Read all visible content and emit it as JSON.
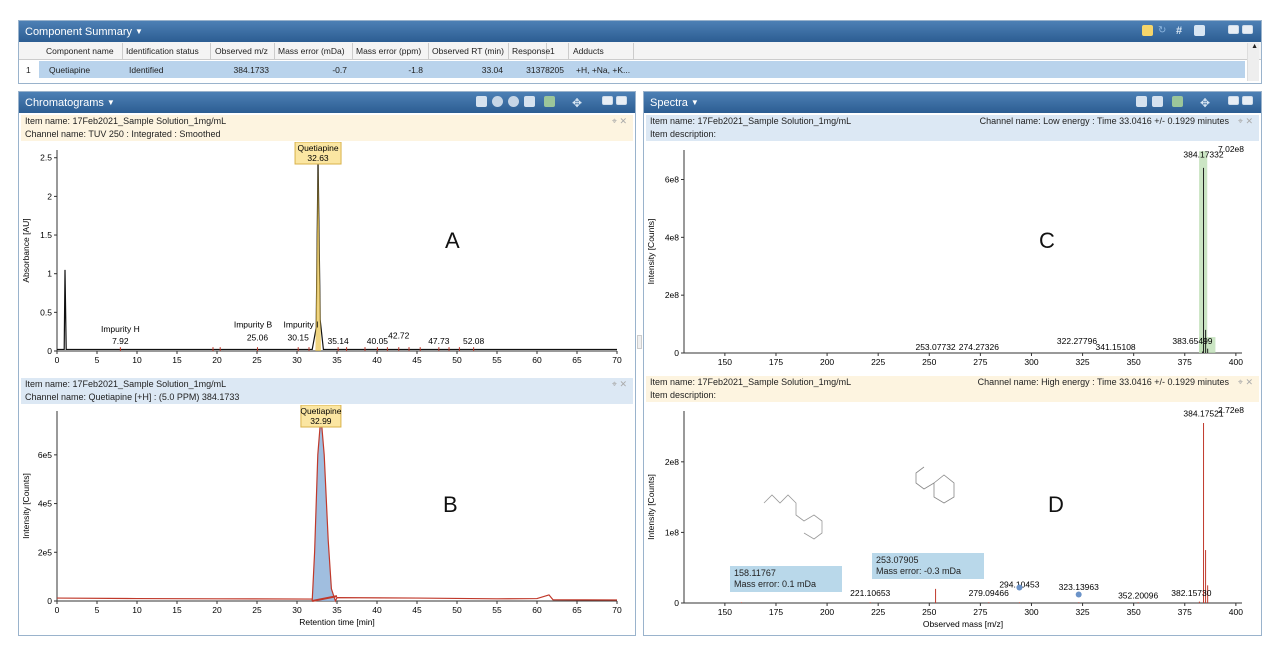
{
  "summary": {
    "title": "Component Summary",
    "columns": [
      "Component name",
      "Identification status",
      "Observed m/z",
      "Mass error (mDa)",
      "Mass error (ppm)",
      "Observed RT (min)",
      "Response",
      "Adducts"
    ],
    "response_sort": "1",
    "row": {
      "index": "1",
      "name": "Quetiapine",
      "status": "Identified",
      "mz": "384.1733",
      "err_mda": "-0.7",
      "err_ppm": "-1.8",
      "rt": "33.04",
      "response": "31378205",
      "adducts": "+H, +Na, +K..."
    }
  },
  "chromatograms": {
    "title": "Chromatograms",
    "a": {
      "item": "Item name: 17Feb2021_Sample Solution_1mg/mL",
      "channel": "Channel name: TUV 250 : Integrated : Smoothed",
      "ylabel": "Absorbance [AU]",
      "letter": "A",
      "yticks": [
        "0",
        "0.5",
        "1",
        "1.5",
        "2",
        "2.5"
      ],
      "peak_label": "Quetiapine",
      "peak_rt": "32.63",
      "impurity_h": "Impurity H",
      "impurity_b": "Impurity B",
      "impurity_i": "Impurity I",
      "annotations": [
        "7.92",
        "25.06",
        "30.15",
        "35.14",
        "40.05",
        "42.72",
        "47.73",
        "52.08"
      ]
    },
    "b": {
      "item": "Item name: 17Feb2021_Sample Solution_1mg/mL",
      "channel": "Channel name: Quetiapine [+H] : (5.0 PPM) 384.1733",
      "ylabel": "Intensity [Counts]",
      "letter": "B",
      "yticks": [
        "0",
        "2e5",
        "4e5",
        "6e5"
      ],
      "peak_label": "Quetiapine",
      "peak_rt": "32.99",
      "xlabel": "Retention time [min]"
    },
    "xticks": [
      "0",
      "5",
      "10",
      "15",
      "20",
      "25",
      "30",
      "35",
      "40",
      "45",
      "50",
      "55",
      "60",
      "65",
      "70"
    ]
  },
  "spectra": {
    "title": "Spectra",
    "c": {
      "item": "Item name: 17Feb2021_Sample Solution_1mg/mL",
      "channel": "Channel name: Low energy : Time 33.0416 +/- 0.1929 minutes",
      "desc": "Item description:",
      "ylabel": "Intensity [Counts]",
      "letter": "C",
      "max": "7.02e8",
      "yticks": [
        "0",
        "2e8",
        "4e8",
        "6e8"
      ],
      "peaks": [
        "253.07732",
        "274.27326",
        "322.27796",
        "341.15108",
        "383.65499",
        "384.17332"
      ]
    },
    "d": {
      "item": "Item name: 17Feb2021_Sample Solution_1mg/mL",
      "channel": "Channel name: High energy : Time 33.0416 +/- 0.1929 minutes",
      "desc": "Item description:",
      "ylabel": "Intensity [Counts]",
      "letter": "D",
      "max": "2.72e8",
      "yticks": [
        "0",
        "1e8",
        "2e8"
      ],
      "peaks": [
        "221.10653",
        "279.09466",
        "294.10453",
        "323.13963",
        "352.20096",
        "382.15730",
        "384.17521"
      ],
      "box1_mass": "158.11767",
      "box1_err": "Mass error: 0.1 mDa",
      "box2_mass": "253.07905",
      "box2_err": "Mass error: -0.3 mDa",
      "xlabel": "Observed mass [m/z]"
    },
    "xticks": [
      "150",
      "175",
      "200",
      "225",
      "250",
      "275",
      "300",
      "325",
      "350",
      "375",
      "400"
    ]
  }
}
